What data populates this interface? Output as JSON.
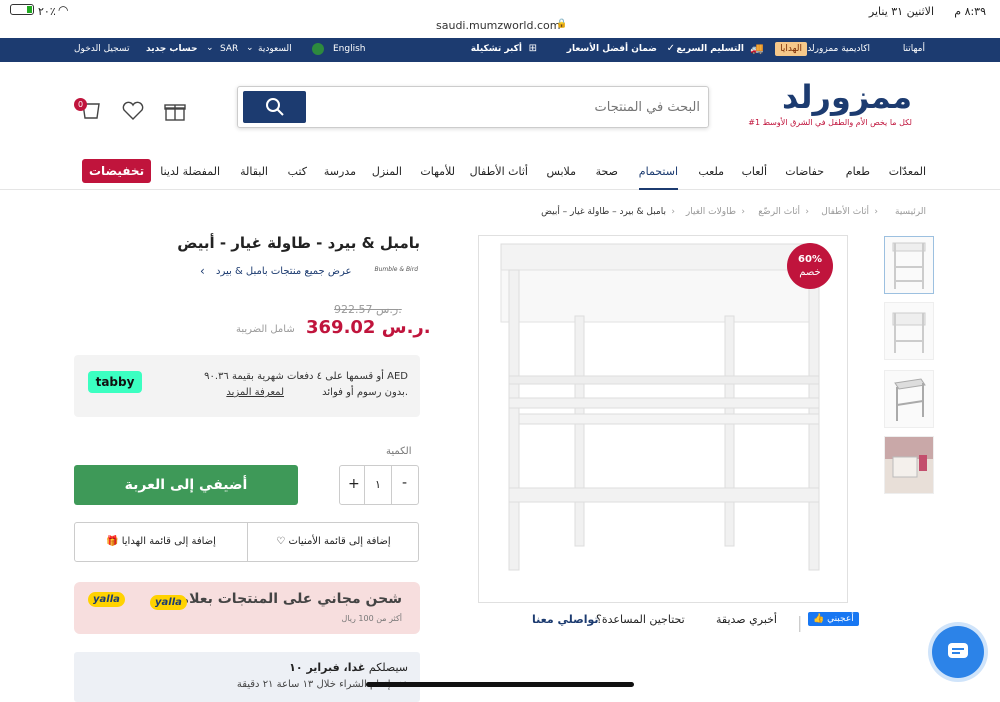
{
  "status": {
    "time": "٨:٣٩ م",
    "date": "الاثنين ٣١ يناير",
    "url": "saudi.mumzworld.com",
    "battery": "٢٠٪"
  },
  "topbar": {
    "mothers": "أمهاتنا",
    "academy": "اكاديمية ممزورلد",
    "gifts": "الهدايا",
    "fast_delivery": "التسليم السريع",
    "best_price": "ضمان أفضل الأسعار",
    "largest": "أكبر تشكيلة",
    "english": "English",
    "country": "السعودية",
    "currency": "SAR",
    "new_account": "حساب جديد",
    "login": "تسجيل الدخول"
  },
  "header": {
    "logo": "ممزورلد",
    "tagline": "#1 لكل ما يخص الأم والطفل في الشرق الأوسط",
    "search_placeholder": "البحث في المنتجات",
    "cart_count": "0"
  },
  "nav": {
    "items": [
      "المعدّات",
      "طعام",
      "حفاضات",
      "ألعاب",
      "ملعب",
      "استحمام",
      "صحة",
      "ملابس",
      "أثاث الأطفال",
      "للأمهات",
      "المنزل",
      "مدرسة",
      "كتب",
      "البقالة",
      "المفضلة لدينا"
    ],
    "sale": "تخفيضات"
  },
  "breadcrumb": [
    "الرئيسية",
    "أثاث الأطفال",
    "أثاث الرضّع",
    "طاولات الغيار",
    "بامبل & بيرد – طاولة غيار – أبيض"
  ],
  "product": {
    "title": "بامبل & بيرد - طاولة غيار - أبيض",
    "brand_link": "عرض جميع منتجات بامبل & بيرد",
    "brand_logo": "Bumble & Bird",
    "old_price": "922.57 ر.س.",
    "price": "369.02 ر.س.",
    "tax_note": "شامل الضريبة",
    "discount_pct": "60%",
    "discount_label": "خصم",
    "tabby_text_1": "أو قسمها على ٤ دفعات شهرية بقيمة ٩٠.٣٦ AED",
    "tabby_text_2": "بدون رسوم أو فوائد.",
    "tabby_learn": "لمعرفة المزيد",
    "tabby_logo": "tabby",
    "qty_label": "الكمية",
    "qty_value": "١",
    "add_to_cart": "أضيفي إلى العربة",
    "wishlist": "إضافة إلى قائمة الأمنيات",
    "gift_list": "إضافة إلى قائمة الهدايا",
    "promo_title": "شحن مجاني على المنتجات بعلامة",
    "promo_sub": "أكثر من 100 ريال",
    "yalla": "yalla",
    "delivery_1a": "سيصلكم",
    "delivery_1b": "غدا، فبراير ١٠",
    "delivery_2": "عند إتمام الشراء خلال ١٣ ساعة ٢١ دقيقة"
  },
  "help": {
    "like": "أعجبني",
    "tell_friend": "أخبري صديقة",
    "need_help": "تحتاجين المساعدة؟",
    "contact": "تواصلي معنا"
  }
}
